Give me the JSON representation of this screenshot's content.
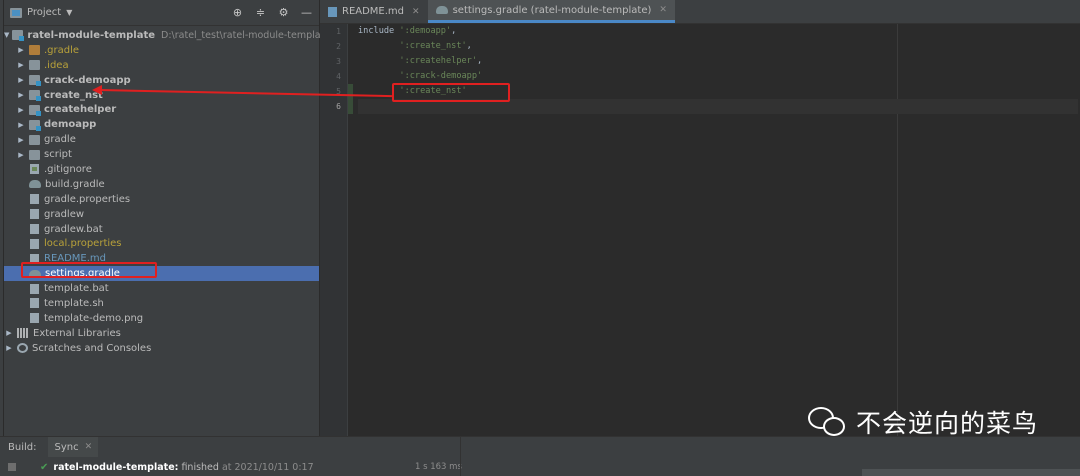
{
  "project_panel": {
    "title": "Project",
    "tools": [
      "target-icon",
      "collapse-icon",
      "gear-icon",
      "minimize-icon"
    ],
    "root": {
      "name": "ratel-module-template",
      "path": "D:\\ratel_test\\ratel-module-template"
    },
    "items": [
      {
        "label": ".gradle",
        "style": "yellow"
      },
      {
        "label": ".idea",
        "style": "yellow"
      },
      {
        "label": "crack-demoapp",
        "style": "bold"
      },
      {
        "label": "create_nst",
        "style": "bold"
      },
      {
        "label": "createhelper",
        "style": "bold"
      },
      {
        "label": "demoapp",
        "style": "bold"
      },
      {
        "label": "gradle",
        "style": "normal"
      },
      {
        "label": "script",
        "style": "normal"
      },
      {
        "label": ".gitignore",
        "style": "normal"
      },
      {
        "label": "build.gradle",
        "style": "normal"
      },
      {
        "label": "gradle.properties",
        "style": "normal"
      },
      {
        "label": "gradlew",
        "style": "normal"
      },
      {
        "label": "gradlew.bat",
        "style": "normal"
      },
      {
        "label": "local.properties",
        "style": "yellow"
      },
      {
        "label": "README.md",
        "style": "blue"
      },
      {
        "label": "settings.gradle",
        "style": "selected"
      },
      {
        "label": "template.bat",
        "style": "normal"
      },
      {
        "label": "template.sh",
        "style": "normal"
      },
      {
        "label": "template-demo.png",
        "style": "normal"
      },
      {
        "label": "External Libraries",
        "style": "normal"
      },
      {
        "label": "Scratches and Consoles",
        "style": "normal"
      }
    ]
  },
  "editor": {
    "tabs": [
      {
        "label": "README.md",
        "active": false
      },
      {
        "label": "settings.gradle (ratel-module-template)",
        "active": true
      }
    ],
    "line_numbers": [
      "1",
      "2",
      "3",
      "4",
      "5",
      "6"
    ],
    "code_lines": [
      {
        "kw": "include ",
        "str": "':demoapp'",
        "tail": ","
      },
      {
        "kw": "        ",
        "str": "':create_nst'",
        "tail": ","
      },
      {
        "kw": "        ",
        "str": "':createhelper'",
        "tail": ","
      },
      {
        "kw": "        ",
        "str": "':crack-demoapp'",
        "tail": ""
      },
      {
        "kw": "        ",
        "str": "':create_nst'",
        "tail": ""
      },
      {
        "kw": "",
        "str": "",
        "tail": ""
      }
    ]
  },
  "bottom": {
    "build_label": "Build:",
    "sync_tab": "Sync",
    "build_name": "ratel-module-template:",
    "build_status": "finished",
    "build_time": "at 2021/10/11 0:17",
    "build_duration": "1 s 163 ms"
  },
  "watermark": {
    "text": "不会逆向的菜鸟"
  },
  "colors": {
    "annotation": "#e02020",
    "selection": "#4b6eaf",
    "string": "#6a8759"
  }
}
